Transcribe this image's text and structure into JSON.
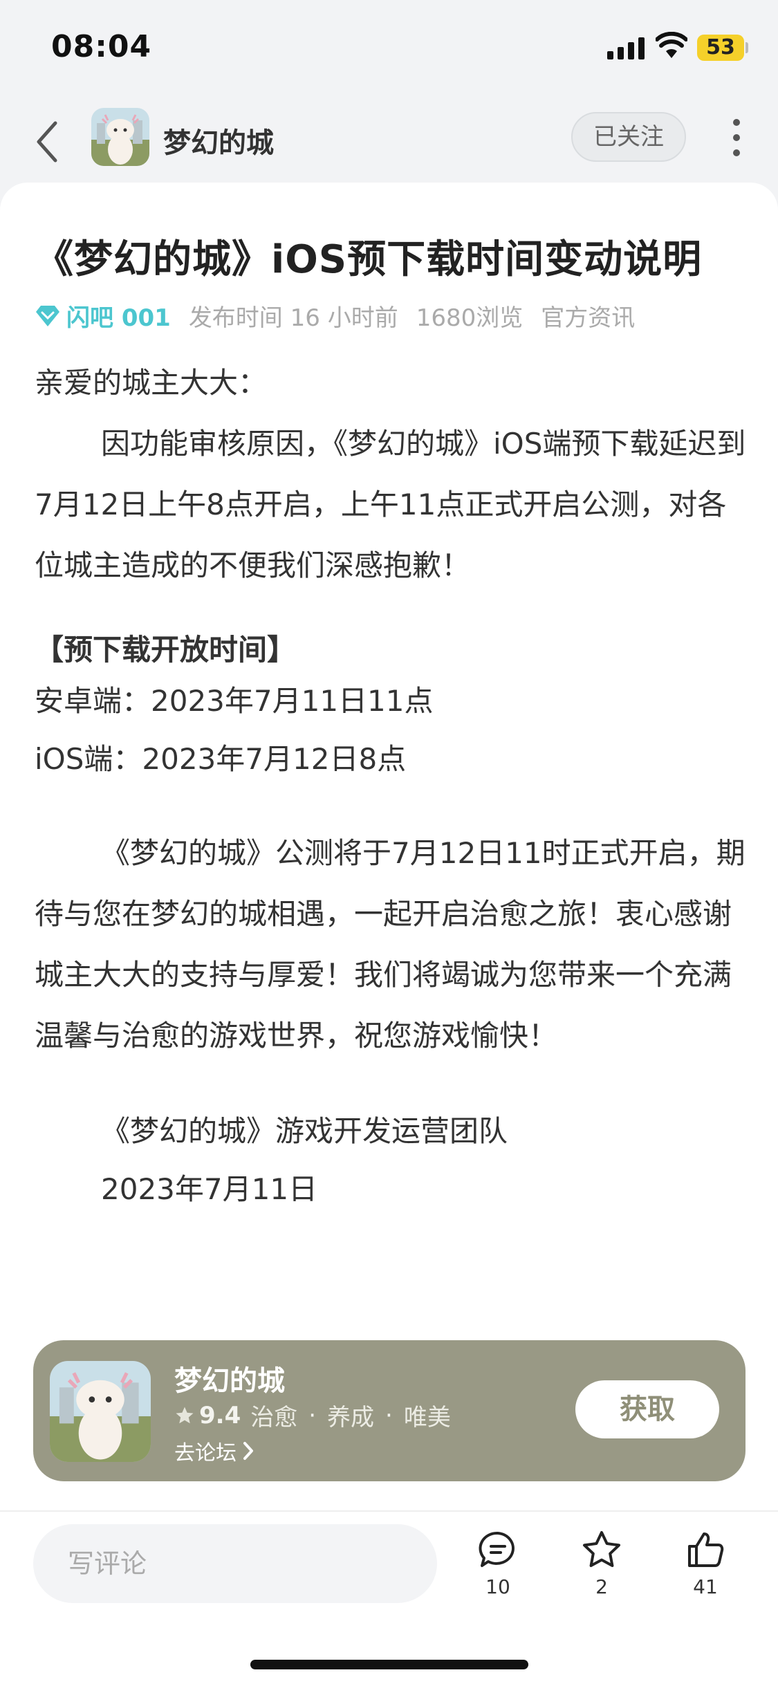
{
  "status_bar": {
    "time": "08:04",
    "battery": "53"
  },
  "header": {
    "game_name": "梦幻的城",
    "follow_label": "已关注"
  },
  "article": {
    "title": "《梦幻的城》iOS预下载时间变动说明",
    "author": "闪吧 001",
    "publish_time": "发布时间 16 小时前",
    "views": "1680浏览",
    "category": "官方资讯",
    "greeting": "亲爱的城主大大：",
    "para1": "因功能审核原因，《梦幻的城》iOS端预下载延迟到7月12日上午8点开启，上午11点正式开启公测，对各位城主造成的不便我们深感抱歉！",
    "section_heading": "【预下载开放时间】",
    "android_time": "安卓端：2023年7月11日11点",
    "ios_time": "iOS端：2023年7月12日8点",
    "para2": "《梦幻的城》公测将于7月12日11时正式开启，期待与您在梦幻的城相遇，一起开启治愈之旅！衷心感谢城主大大的支持与厚爱！我们将竭诚为您带来一个充满温馨与治愈的游戏世界，祝您游戏愉快！",
    "signature": "《梦幻的城》游戏开发运营团队",
    "date": "2023年7月11日"
  },
  "game_banner": {
    "name": "梦幻的城",
    "rating": "9.4",
    "tags": [
      "治愈",
      "养成",
      "唯美"
    ],
    "forum_link": "去论坛",
    "get_label": "获取"
  },
  "bottom_bar": {
    "comment_placeholder": "写评论",
    "comments_count": "10",
    "favorites_count": "2",
    "likes_count": "41"
  }
}
